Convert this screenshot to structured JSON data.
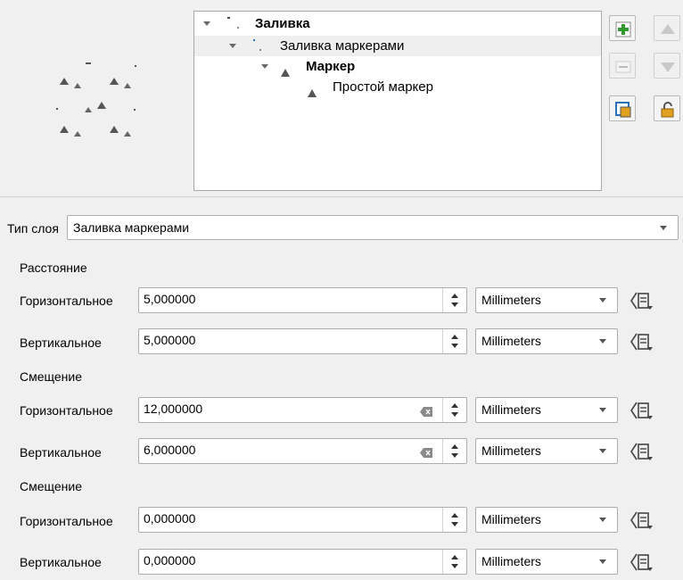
{
  "tree": {
    "items": [
      {
        "label": "Заливка",
        "bold": true
      },
      {
        "label": "Заливка маркерами",
        "bold": false
      },
      {
        "label": "Маркер",
        "bold": true
      },
      {
        "label": "Простой маркер",
        "bold": false
      }
    ]
  },
  "side_buttons": [
    {
      "icon": "add-layer-icon"
    },
    {
      "icon": "move-up-icon"
    },
    {
      "icon": "remove-layer-icon"
    },
    {
      "icon": "move-down-icon"
    },
    {
      "icon": "duplicate-layer-icon"
    },
    {
      "icon": "lock-icon"
    }
  ],
  "layer_type": {
    "label": "Тип слоя",
    "value": "Заливка маркерами"
  },
  "sections": {
    "distance": "Расстояние",
    "displacement": "Смещение",
    "offset": "Смещение"
  },
  "rows": [
    {
      "label": "Горизонтальное",
      "value": "5,000000",
      "unit": "Millimeters",
      "clear": false
    },
    {
      "label": "Вертикальное",
      "value": "5,000000",
      "unit": "Millimeters",
      "clear": false
    },
    {
      "label": "Горизонтальное",
      "value": "12,000000",
      "unit": "Millimeters",
      "clear": true
    },
    {
      "label": "Вертикальное",
      "value": "6,000000",
      "unit": "Millimeters",
      "clear": true
    },
    {
      "label": "Горизонтальное",
      "value": "0,000000",
      "unit": "Millimeters",
      "clear": false
    },
    {
      "label": "Вертикальное",
      "value": "0,000000",
      "unit": "Millimeters",
      "clear": false
    }
  ],
  "colors": {
    "selection": "#efefef",
    "add_green": "#2e9a2e",
    "lock_orange": "#e0a020",
    "blue_square": "#2a6fb8"
  }
}
